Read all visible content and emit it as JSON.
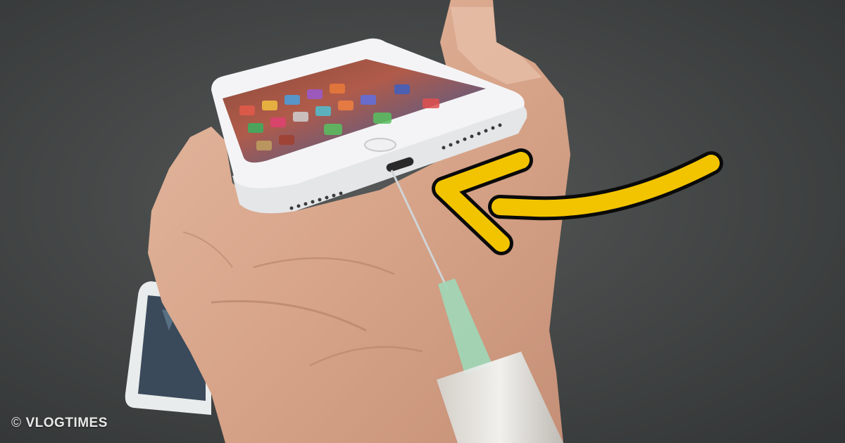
{
  "watermark": {
    "symbol": "©",
    "text": "VLOGTIMES"
  },
  "colors": {
    "background": "#3d4040",
    "arrow": "#f2c400",
    "arrow_outline": "#0a0a0a",
    "skin": "#d9a98f",
    "phone_body": "#f1f1f3"
  },
  "icons": {
    "arrow": "curved-arrow-icon"
  }
}
